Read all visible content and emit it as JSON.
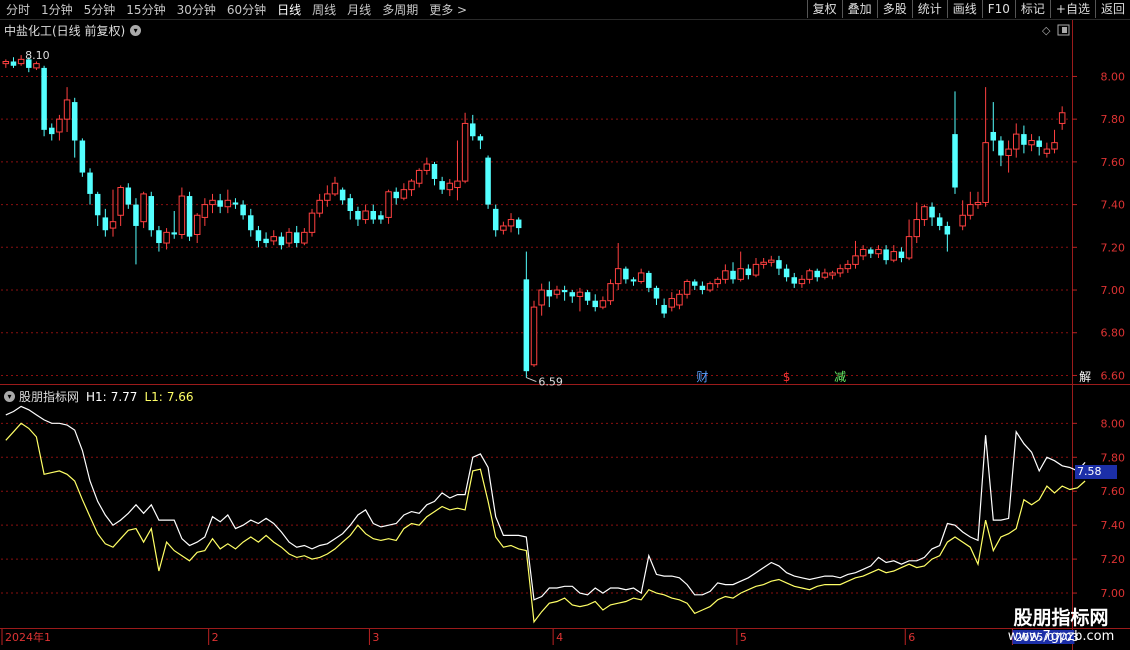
{
  "toolbar": {
    "periods": [
      "分时",
      "1分钟",
      "5分钟",
      "15分钟",
      "30分钟",
      "60分钟",
      "日线",
      "周线",
      "月线",
      "多周期",
      "更多 >"
    ],
    "active_period": "日线",
    "tools": [
      "复权",
      "叠加",
      "多股",
      "统计",
      "画线",
      "F10",
      "标记",
      "+自选",
      "返回"
    ]
  },
  "main_panel": {
    "title": "中盐化工(日线 前复权)",
    "high_label": "8.10",
    "low_label": "6.59",
    "event_markers": [
      {
        "text": "财",
        "index": 91,
        "color": "#5aa0ff"
      },
      {
        "text": "$",
        "index": 102,
        "color": "#ff3333"
      },
      {
        "text": "减",
        "index": 109,
        "color": "#66ee66"
      },
      {
        "text": "解",
        "index": 141,
        "color": "#ffffff"
      }
    ]
  },
  "indicator_panel": {
    "name": "股朋指标网",
    "h1_label": "H1:",
    "h1_value": "7.77",
    "l1_label": "L1:",
    "l1_value": "7.66",
    "current_tag": "7.58"
  },
  "x_axis": {
    "labels": [
      {
        "text": "2024年1",
        "index": 0
      },
      {
        "text": "2",
        "index": 27
      },
      {
        "text": "3",
        "index": 48
      },
      {
        "text": "4",
        "index": 72
      },
      {
        "text": "5",
        "index": 96
      },
      {
        "text": "6",
        "index": 118
      },
      {
        "text": "2025/07/03",
        "index": 132,
        "highlight": true
      }
    ]
  },
  "watermark": {
    "line1": "股朋指标网",
    "line2": "www.7gpzb.com"
  },
  "colors": {
    "up": "#ff4040",
    "down": "#54ffff",
    "h1": "#ffffff",
    "l1": "#ffff66",
    "grid": "#8a1010",
    "frame": "#9b1b1b"
  },
  "chart_data": {
    "type": "candlestick",
    "y_axis_main": {
      "ticks": [
        "8.00",
        "7.80",
        "7.60",
        "7.40",
        "7.20",
        "7.00",
        "6.80",
        "6.60"
      ],
      "range": [
        6.56,
        8.18
      ]
    },
    "y_axis_indicator": {
      "ticks": [
        "8.00",
        "7.80",
        "7.60",
        "7.40",
        "7.20",
        "7.00"
      ],
      "range": [
        6.8,
        8.22
      ]
    },
    "candles": [
      [
        8.06,
        8.07,
        8.04,
        8.08
      ],
      [
        8.07,
        8.05,
        8.04,
        8.09
      ],
      [
        8.06,
        8.08,
        8.05,
        8.1
      ],
      [
        8.08,
        8.04,
        8.02,
        8.09
      ],
      [
        8.04,
        8.06,
        8.03,
        8.07
      ],
      [
        8.04,
        7.75,
        7.72,
        8.05
      ],
      [
        7.76,
        7.73,
        7.7,
        7.78
      ],
      [
        7.74,
        7.8,
        7.7,
        7.82
      ],
      [
        7.8,
        7.89,
        7.74,
        7.95
      ],
      [
        7.88,
        7.7,
        7.62,
        7.9
      ],
      [
        7.7,
        7.55,
        7.53,
        7.71
      ],
      [
        7.55,
        7.45,
        7.4,
        7.57
      ],
      [
        7.45,
        7.35,
        7.3,
        7.46
      ],
      [
        7.34,
        7.28,
        7.25,
        7.38
      ],
      [
        7.29,
        7.32,
        7.25,
        7.47
      ],
      [
        7.35,
        7.48,
        7.3,
        7.49
      ],
      [
        7.48,
        7.4,
        7.38,
        7.5
      ],
      [
        7.4,
        7.3,
        7.12,
        7.43
      ],
      [
        7.32,
        7.45,
        7.29,
        7.46
      ],
      [
        7.44,
        7.28,
        7.25,
        7.46
      ],
      [
        7.28,
        7.22,
        7.18,
        7.3
      ],
      [
        7.22,
        7.27,
        7.19,
        7.29
      ],
      [
        7.27,
        7.26,
        7.24,
        7.37
      ],
      [
        7.26,
        7.44,
        7.24,
        7.48
      ],
      [
        7.44,
        7.25,
        7.23,
        7.46
      ],
      [
        7.26,
        7.35,
        7.22,
        7.36
      ],
      [
        7.34,
        7.4,
        7.3,
        7.43
      ],
      [
        7.4,
        7.42,
        7.36,
        7.45
      ],
      [
        7.42,
        7.39,
        7.36,
        7.45
      ],
      [
        7.39,
        7.42,
        7.36,
        7.47
      ],
      [
        7.41,
        7.4,
        7.38,
        7.43
      ],
      [
        7.4,
        7.35,
        7.33,
        7.42
      ],
      [
        7.35,
        7.28,
        7.25,
        7.38
      ],
      [
        7.28,
        7.23,
        7.2,
        7.3
      ],
      [
        7.24,
        7.22,
        7.2,
        7.27
      ],
      [
        7.23,
        7.25,
        7.21,
        7.28
      ],
      [
        7.25,
        7.21,
        7.19,
        7.27
      ],
      [
        7.22,
        7.27,
        7.2,
        7.29
      ],
      [
        7.27,
        7.22,
        7.2,
        7.3
      ],
      [
        7.22,
        7.27,
        7.21,
        7.29
      ],
      [
        7.27,
        7.36,
        7.25,
        7.38
      ],
      [
        7.36,
        7.42,
        7.34,
        7.45
      ],
      [
        7.42,
        7.45,
        7.39,
        7.49
      ],
      [
        7.45,
        7.5,
        7.44,
        7.53
      ],
      [
        7.47,
        7.42,
        7.4,
        7.48
      ],
      [
        7.43,
        7.37,
        7.33,
        7.45
      ],
      [
        7.37,
        7.33,
        7.3,
        7.39
      ],
      [
        7.33,
        7.37,
        7.31,
        7.4
      ],
      [
        7.37,
        7.33,
        7.31,
        7.4
      ],
      [
        7.35,
        7.33,
        7.31,
        7.37
      ],
      [
        7.34,
        7.46,
        7.31,
        7.47
      ],
      [
        7.46,
        7.43,
        7.4,
        7.48
      ],
      [
        7.43,
        7.47,
        7.42,
        7.5
      ],
      [
        7.47,
        7.51,
        7.44,
        7.52
      ],
      [
        7.5,
        7.56,
        7.48,
        7.57
      ],
      [
        7.56,
        7.59,
        7.54,
        7.62
      ],
      [
        7.59,
        7.52,
        7.49,
        7.6
      ],
      [
        7.51,
        7.47,
        7.45,
        7.53
      ],
      [
        7.47,
        7.5,
        7.44,
        7.52
      ],
      [
        7.48,
        7.51,
        7.42,
        7.7
      ],
      [
        7.51,
        7.78,
        7.5,
        7.83
      ],
      [
        7.78,
        7.72,
        7.7,
        7.82
      ],
      [
        7.72,
        7.7,
        7.66,
        7.73
      ],
      [
        7.62,
        7.4,
        7.38,
        7.63
      ],
      [
        7.38,
        7.28,
        7.25,
        7.4
      ],
      [
        7.28,
        7.3,
        7.26,
        7.32
      ],
      [
        7.3,
        7.33,
        7.27,
        7.36
      ],
      [
        7.33,
        7.29,
        7.26,
        7.34
      ],
      [
        7.05,
        6.62,
        6.59,
        7.18
      ],
      [
        6.65,
        6.92,
        6.64,
        6.95
      ],
      [
        6.93,
        7.0,
        6.88,
        7.03
      ],
      [
        7.0,
        6.97,
        6.92,
        7.04
      ],
      [
        6.98,
        7.0,
        6.96,
        7.02
      ],
      [
        7.0,
        6.99,
        6.95,
        7.02
      ],
      [
        6.99,
        6.97,
        6.94,
        7.0
      ],
      [
        6.97,
        6.99,
        6.9,
        7.01
      ],
      [
        6.99,
        6.95,
        6.93,
        7.0
      ],
      [
        6.95,
        6.92,
        6.9,
        6.98
      ],
      [
        6.92,
        6.95,
        6.91,
        6.97
      ],
      [
        6.95,
        7.03,
        6.93,
        7.05
      ],
      [
        7.03,
        7.1,
        7.0,
        7.22
      ],
      [
        7.1,
        7.05,
        7.03,
        7.11
      ],
      [
        7.05,
        7.04,
        7.02,
        7.06
      ],
      [
        7.04,
        7.08,
        7.03,
        7.1
      ],
      [
        7.08,
        7.01,
        6.99,
        7.09
      ],
      [
        7.01,
        6.96,
        6.93,
        7.02
      ],
      [
        6.93,
        6.89,
        6.87,
        6.96
      ],
      [
        6.92,
        6.96,
        6.9,
        6.99
      ],
      [
        6.93,
        6.98,
        6.91,
        7.0
      ],
      [
        6.98,
        7.04,
        6.96,
        7.05
      ],
      [
        7.04,
        7.02,
        7.0,
        7.05
      ],
      [
        7.02,
        7.0,
        6.98,
        7.04
      ],
      [
        7.0,
        7.03,
        6.99,
        7.04
      ],
      [
        7.03,
        7.05,
        7.01,
        7.06
      ],
      [
        7.05,
        7.09,
        7.03,
        7.12
      ],
      [
        7.09,
        7.05,
        7.03,
        7.13
      ],
      [
        7.05,
        7.1,
        7.04,
        7.18
      ],
      [
        7.1,
        7.07,
        7.05,
        7.12
      ],
      [
        7.07,
        7.12,
        7.06,
        7.15
      ],
      [
        7.12,
        7.13,
        7.1,
        7.15
      ],
      [
        7.13,
        7.14,
        7.11,
        7.16
      ],
      [
        7.14,
        7.1,
        7.07,
        7.16
      ],
      [
        7.1,
        7.06,
        7.04,
        7.12
      ],
      [
        7.06,
        7.03,
        7.01,
        7.08
      ],
      [
        7.03,
        7.05,
        7.01,
        7.07
      ],
      [
        7.05,
        7.09,
        7.03,
        7.1
      ],
      [
        7.09,
        7.06,
        7.04,
        7.1
      ],
      [
        7.06,
        7.08,
        7.05,
        7.1
      ],
      [
        7.07,
        7.08,
        7.05,
        7.09
      ],
      [
        7.08,
        7.1,
        7.06,
        7.12
      ],
      [
        7.1,
        7.12,
        7.08,
        7.14
      ],
      [
        7.12,
        7.16,
        7.1,
        7.23
      ],
      [
        7.16,
        7.19,
        7.14,
        7.21
      ],
      [
        7.19,
        7.17,
        7.15,
        7.2
      ],
      [
        7.17,
        7.19,
        7.15,
        7.21
      ],
      [
        7.19,
        7.14,
        7.12,
        7.21
      ],
      [
        7.14,
        7.18,
        7.13,
        7.21
      ],
      [
        7.18,
        7.15,
        7.13,
        7.2
      ],
      [
        7.15,
        7.25,
        7.14,
        7.33
      ],
      [
        7.25,
        7.33,
        7.22,
        7.41
      ],
      [
        7.33,
        7.39,
        7.3,
        7.4
      ],
      [
        7.39,
        7.34,
        7.3,
        7.41
      ],
      [
        7.34,
        7.3,
        7.28,
        7.36
      ],
      [
        7.3,
        7.26,
        7.18,
        7.32
      ],
      [
        7.73,
        7.48,
        7.45,
        7.93
      ],
      [
        7.3,
        7.35,
        7.28,
        7.42
      ],
      [
        7.35,
        7.4,
        7.33,
        7.46
      ],
      [
        7.4,
        7.41,
        7.38,
        7.46
      ],
      [
        7.41,
        7.69,
        7.39,
        7.95
      ],
      [
        7.74,
        7.7,
        7.65,
        7.88
      ],
      [
        7.7,
        7.63,
        7.58,
        7.72
      ],
      [
        7.63,
        7.66,
        7.55,
        7.7
      ],
      [
        7.66,
        7.73,
        7.62,
        7.78
      ],
      [
        7.73,
        7.68,
        7.64,
        7.77
      ],
      [
        7.68,
        7.7,
        7.65,
        7.73
      ],
      [
        7.7,
        7.67,
        7.63,
        7.72
      ],
      [
        7.64,
        7.66,
        7.62,
        7.69
      ],
      [
        7.66,
        7.69,
        7.64,
        7.75
      ],
      [
        7.78,
        7.83,
        7.75,
        7.86
      ]
    ],
    "h1": [
      8.05,
      8.07,
      8.1,
      8.08,
      8.05,
      8.02,
      8.0,
      8.0,
      7.99,
      7.96,
      7.84,
      7.66,
      7.54,
      7.46,
      7.4,
      7.43,
      7.47,
      7.52,
      7.47,
      7.52,
      7.43,
      7.43,
      7.43,
      7.32,
      7.28,
      7.3,
      7.33,
      7.45,
      7.42,
      7.46,
      7.38,
      7.4,
      7.43,
      7.41,
      7.44,
      7.41,
      7.36,
      7.3,
      7.27,
      7.28,
      7.26,
      7.28,
      7.29,
      7.32,
      7.35,
      7.4,
      7.46,
      7.49,
      7.41,
      7.39,
      7.4,
      7.41,
      7.46,
      7.48,
      7.47,
      7.52,
      7.54,
      7.59,
      7.56,
      7.58,
      7.58,
      7.8,
      7.82,
      7.74,
      7.45,
      7.34,
      7.34,
      7.34,
      7.33,
      6.96,
      6.98,
      7.03,
      7.03,
      7.04,
      7.04,
      7.0,
      6.99,
      7.03,
      7.0,
      7.03,
      7.03,
      7.02,
      7.03,
      7.0,
      7.22,
      7.11,
      7.1,
      7.1,
      7.09,
      7.05,
      6.99,
      6.99,
      7.01,
      7.06,
      7.05,
      7.05,
      7.07,
      7.09,
      7.12,
      7.15,
      7.18,
      7.16,
      7.12,
      7.1,
      7.09,
      7.08,
      7.09,
      7.1,
      7.1,
      7.09,
      7.11,
      7.12,
      7.14,
      7.16,
      7.21,
      7.18,
      7.19,
      7.17,
      7.19,
      7.19,
      7.21,
      7.26,
      7.28,
      7.41,
      7.4,
      7.36,
      7.33,
      7.31,
      7.93,
      7.43,
      7.43,
      7.44,
      7.95,
      7.88,
      7.83,
      7.72,
      7.8,
      7.78,
      7.75,
      7.74,
      7.72,
      7.77
    ],
    "l1": [
      7.9,
      7.95,
      8.0,
      7.97,
      7.92,
      7.7,
      7.71,
      7.72,
      7.7,
      7.66,
      7.55,
      7.45,
      7.35,
      7.29,
      7.27,
      7.32,
      7.37,
      7.38,
      7.3,
      7.38,
      7.13,
      7.3,
      7.25,
      7.22,
      7.19,
      7.24,
      7.25,
      7.32,
      7.26,
      7.29,
      7.26,
      7.3,
      7.33,
      7.3,
      7.34,
      7.3,
      7.27,
      7.23,
      7.21,
      7.22,
      7.2,
      7.21,
      7.23,
      7.26,
      7.3,
      7.34,
      7.4,
      7.35,
      7.32,
      7.31,
      7.32,
      7.31,
      7.38,
      7.41,
      7.4,
      7.45,
      7.48,
      7.51,
      7.49,
      7.5,
      7.49,
      7.72,
      7.73,
      7.54,
      7.33,
      7.27,
      7.28,
      7.26,
      7.25,
      6.83,
      6.89,
      6.94,
      6.95,
      6.97,
      6.93,
      6.92,
      6.93,
      6.95,
      6.9,
      6.93,
      6.94,
      6.95,
      6.97,
      6.96,
      7.02,
      7.0,
      6.99,
      6.97,
      6.96,
      6.94,
      6.88,
      6.9,
      6.92,
      6.96,
      6.98,
      6.97,
      7.0,
      7.02,
      7.04,
      7.05,
      7.07,
      7.08,
      7.06,
      7.04,
      7.03,
      7.02,
      7.04,
      7.05,
      7.05,
      7.05,
      7.07,
      7.09,
      7.1,
      7.12,
      7.14,
      7.12,
      7.13,
      7.15,
      7.17,
      7.15,
      7.16,
      7.2,
      7.22,
      7.3,
      7.33,
      7.3,
      7.27,
      7.17,
      7.43,
      7.25,
      7.33,
      7.35,
      7.38,
      7.55,
      7.52,
      7.55,
      7.63,
      7.59,
      7.63,
      7.61,
      7.62,
      7.66
    ]
  }
}
